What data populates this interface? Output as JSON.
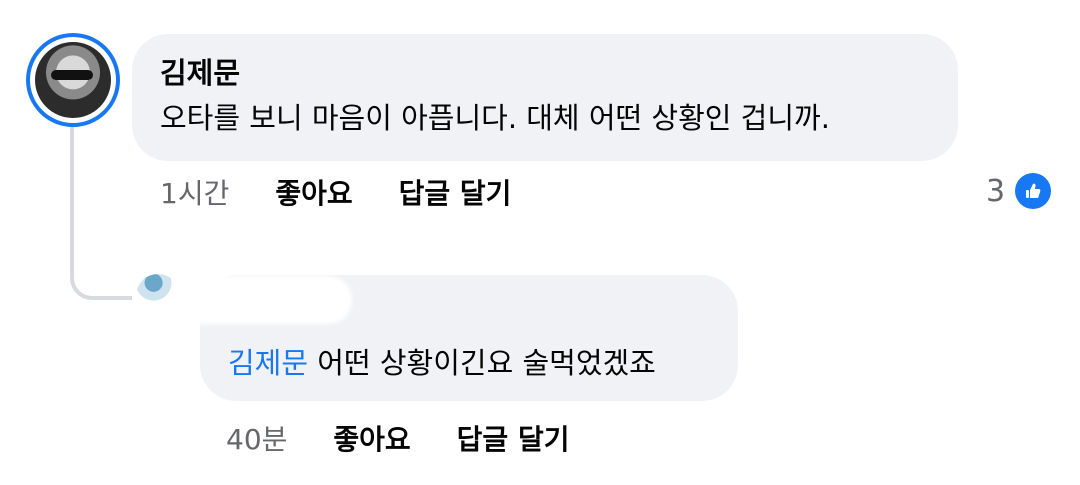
{
  "comment": {
    "author": "김제문",
    "text": "오타를 보니 마음이 아픕니다. 대체 어떤 상황인 겁니까.",
    "time": "1시간",
    "like_label": "좋아요",
    "reply_label": "답글 달기",
    "reaction_count": "3",
    "reaction_icon": "thumbs-up-icon",
    "accent_color": "#1877f2"
  },
  "reply": {
    "mention": "김제문",
    "text": " 어떤 상황이긴요 술먹었겠죠",
    "time": "40분",
    "like_label": "좋아요",
    "reply_label": "답글 달기"
  }
}
